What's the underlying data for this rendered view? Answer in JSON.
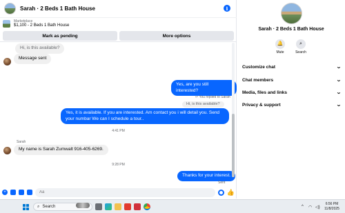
{
  "chat": {
    "title": "Sarah · 2 Beds 1 Bath House",
    "info_icon": "i",
    "listing": {
      "kicker": "Marketplace",
      "text": "$1,100 - 2 Beds 1 Bath House"
    },
    "actions": {
      "mark_pending": "Mark as pending",
      "more_options": "More options"
    },
    "messages": {
      "quoted_original": "Hi, is this available?",
      "message_sent": "Message sent",
      "still_interested": "Yes, are you still interested?",
      "reply_label": "You replied to Sarah",
      "reply_quote": "Hi, is this available?",
      "available_reply": "Yes, it is available. If you are interested. Am contact you i will detail you. Send your numbar We can I schedule a tour..",
      "time_1": "4:41 PM",
      "sender_name": "Sarah",
      "sarah_number": "My name is Sarah Zumwalt 916-405-6269.",
      "time_2": "9:28 PM",
      "thanks": "Thanks for your interest.",
      "sent_status": "Sent"
    },
    "composer": {
      "placeholder": "Aa"
    }
  },
  "info_panel": {
    "name": "Sarah · 2 Beds 1 Bath House",
    "quick_actions": {
      "mute": "Mute",
      "search": "Search"
    },
    "sections": [
      "Customize chat",
      "Chat members",
      "Media, files and links",
      "Privacy & support"
    ]
  },
  "taskbar": {
    "search_placeholder": "Search",
    "time": "6:56 PM",
    "date": "11/8/2025"
  },
  "colors": {
    "accent_blue": "#0866ff",
    "bubble_gray": "#f0f0f0",
    "button_gray": "#e4e6eb",
    "taskbar_bg": "#e9edf1"
  }
}
